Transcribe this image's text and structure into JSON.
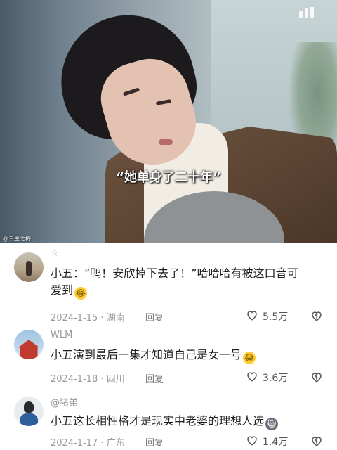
{
  "video": {
    "subtitle": "“她单身了二十年”",
    "watermark": "@三生之梅"
  },
  "comments": [
    {
      "username": "☆",
      "text": "小五：“鸭！安欣掉下去了！”哈哈哈有被这口音可爱到",
      "emoji": "laugh-crying-emoji",
      "date": "2024-1-15",
      "location": "湖南",
      "reply_label": "回复",
      "likes": "5.5万"
    },
    {
      "username": "WLM",
      "text": "小五演到最后一集才知道自己是女一号",
      "emoji": "laugh-crying-emoji",
      "date": "2024-1-18",
      "location": "四川",
      "reply_label": "回复",
      "likes": "3.6万"
    },
    {
      "username": "@猪弟",
      "text": "小五这长相性格才是现实中老婆的理想人选",
      "emoji": "cat-emoji",
      "date": "2024-1-17",
      "location": "广东",
      "reply_label": "回复",
      "likes": "1.4万"
    }
  ],
  "colors": {
    "text": "#1e1e1e",
    "muted": "#9a9a9a",
    "emoji": "#ffcc33"
  },
  "icons": {
    "like": "heart-outline-icon",
    "dislike": "broken-heart-icon"
  }
}
